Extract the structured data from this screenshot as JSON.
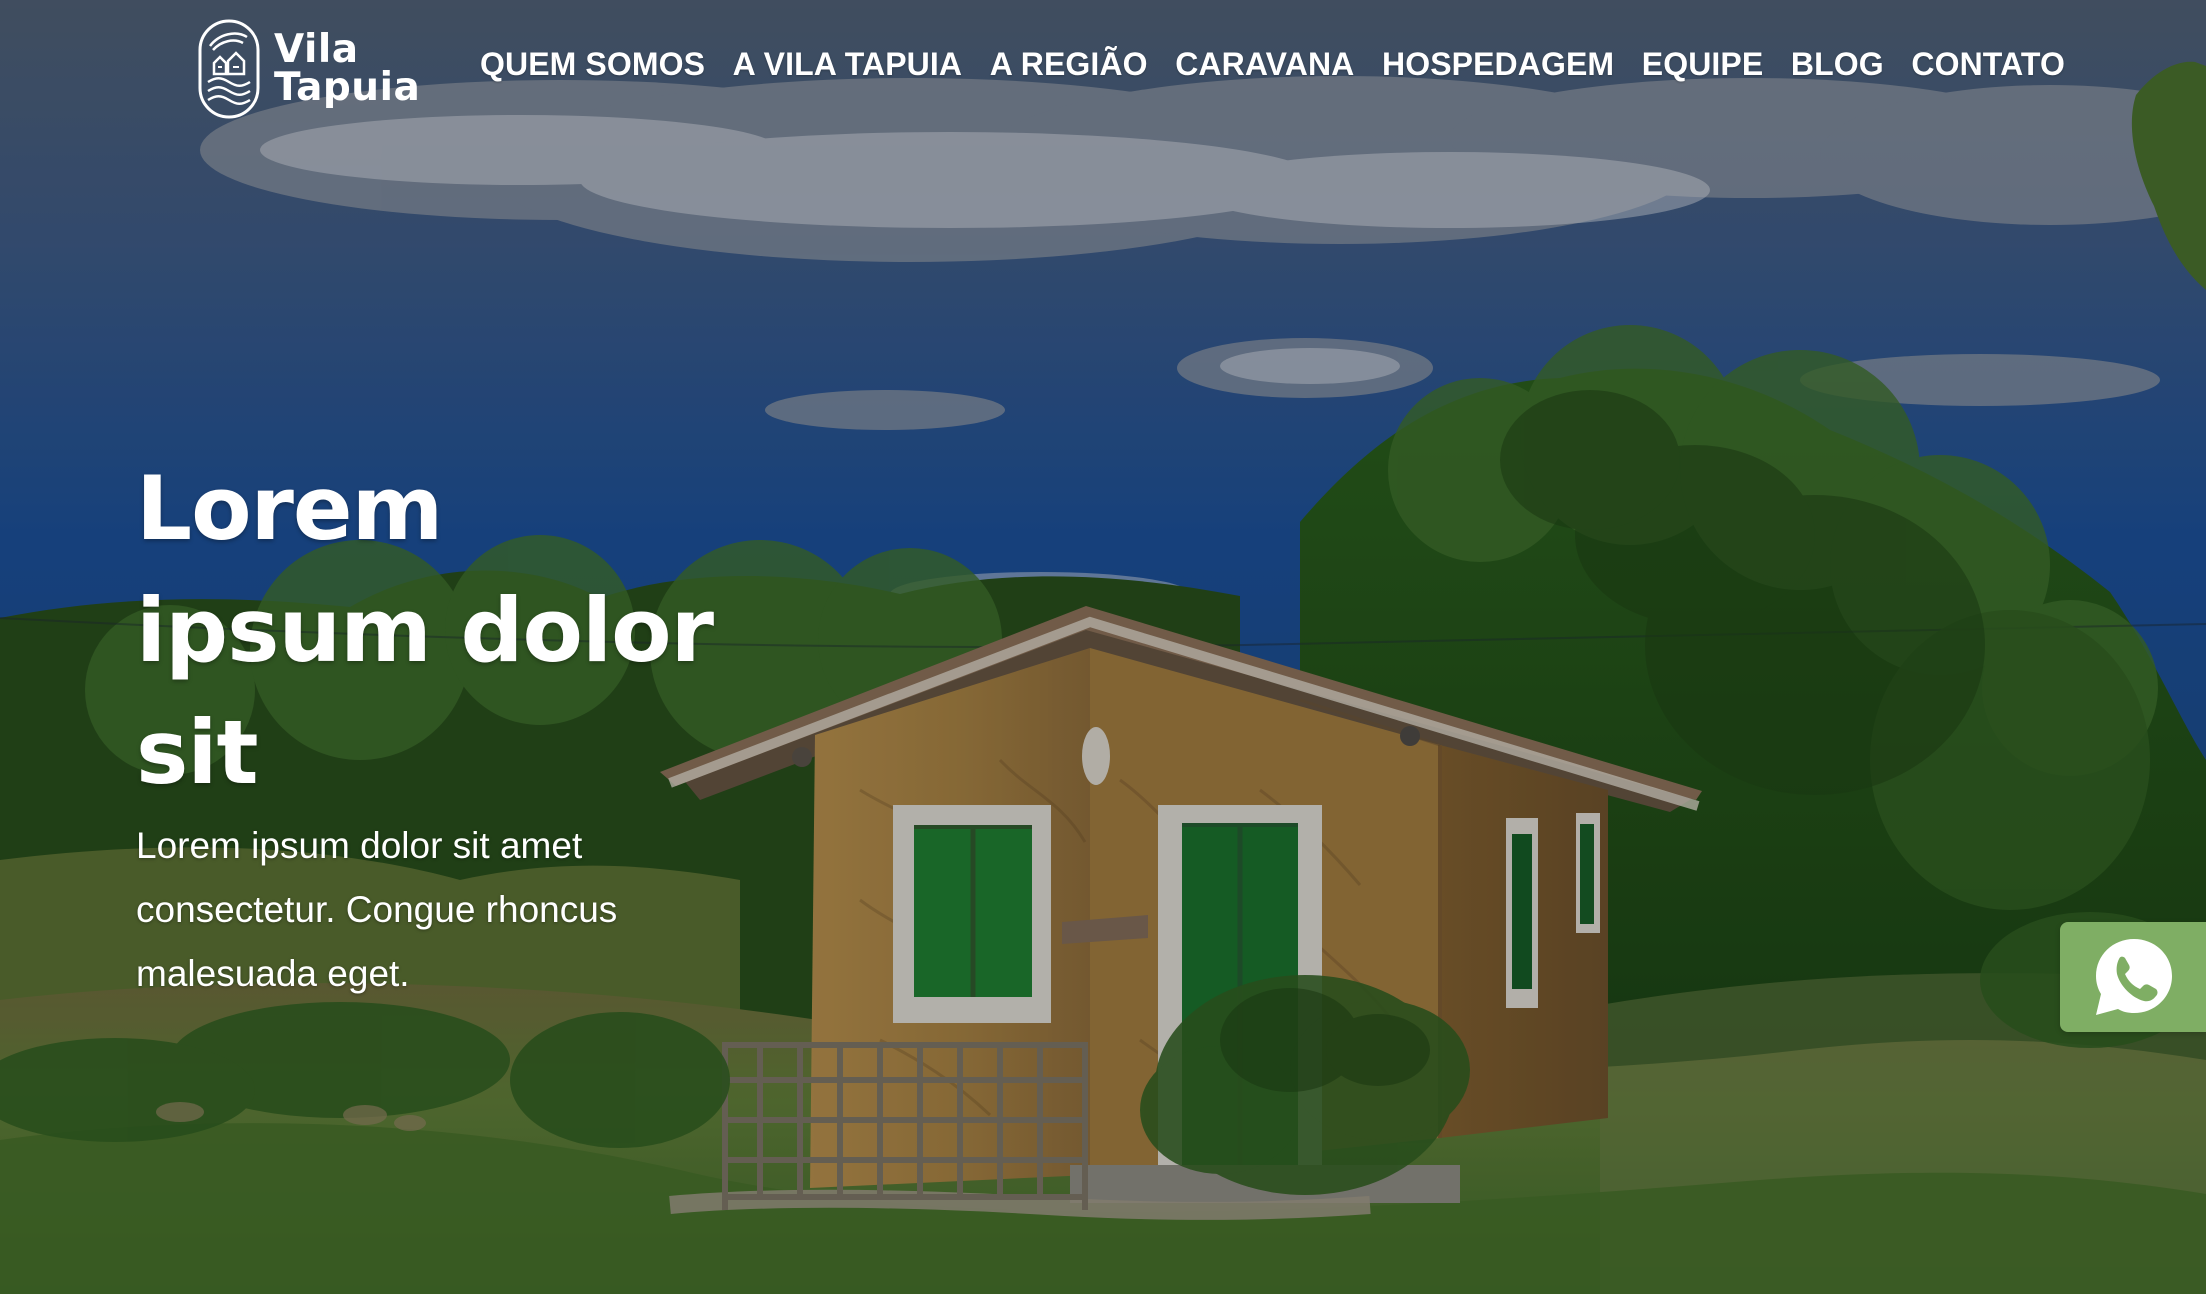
{
  "brand": {
    "name_line1": "Vila",
    "name_line2": "Tapuia",
    "logo_icon": "house-waves-logo-icon"
  },
  "nav": {
    "items": [
      {
        "label": "QUEM SOMOS"
      },
      {
        "label": "A VILA TAPUIA"
      },
      {
        "label": "A REGIÃO"
      },
      {
        "label": "CARAVANA"
      },
      {
        "label": "HOSPEDAGEM"
      },
      {
        "label": "EQUIPE"
      },
      {
        "label": "BLOG"
      },
      {
        "label": "CONTATO"
      }
    ]
  },
  "hero": {
    "title": "Lorem ipsum dolor sit",
    "subtitle": "Lorem ipsum dolor sit amet consectetur. Congue rhoncus malesuada eget."
  },
  "whatsapp": {
    "icon": "whatsapp-icon"
  },
  "colors": {
    "whatsapp_button": "#7fae64",
    "text": "#ffffff",
    "sky": "#1b4f97",
    "foliage": "#2b5a1f",
    "door": "#1f7d31",
    "wall": "#ac8846"
  }
}
